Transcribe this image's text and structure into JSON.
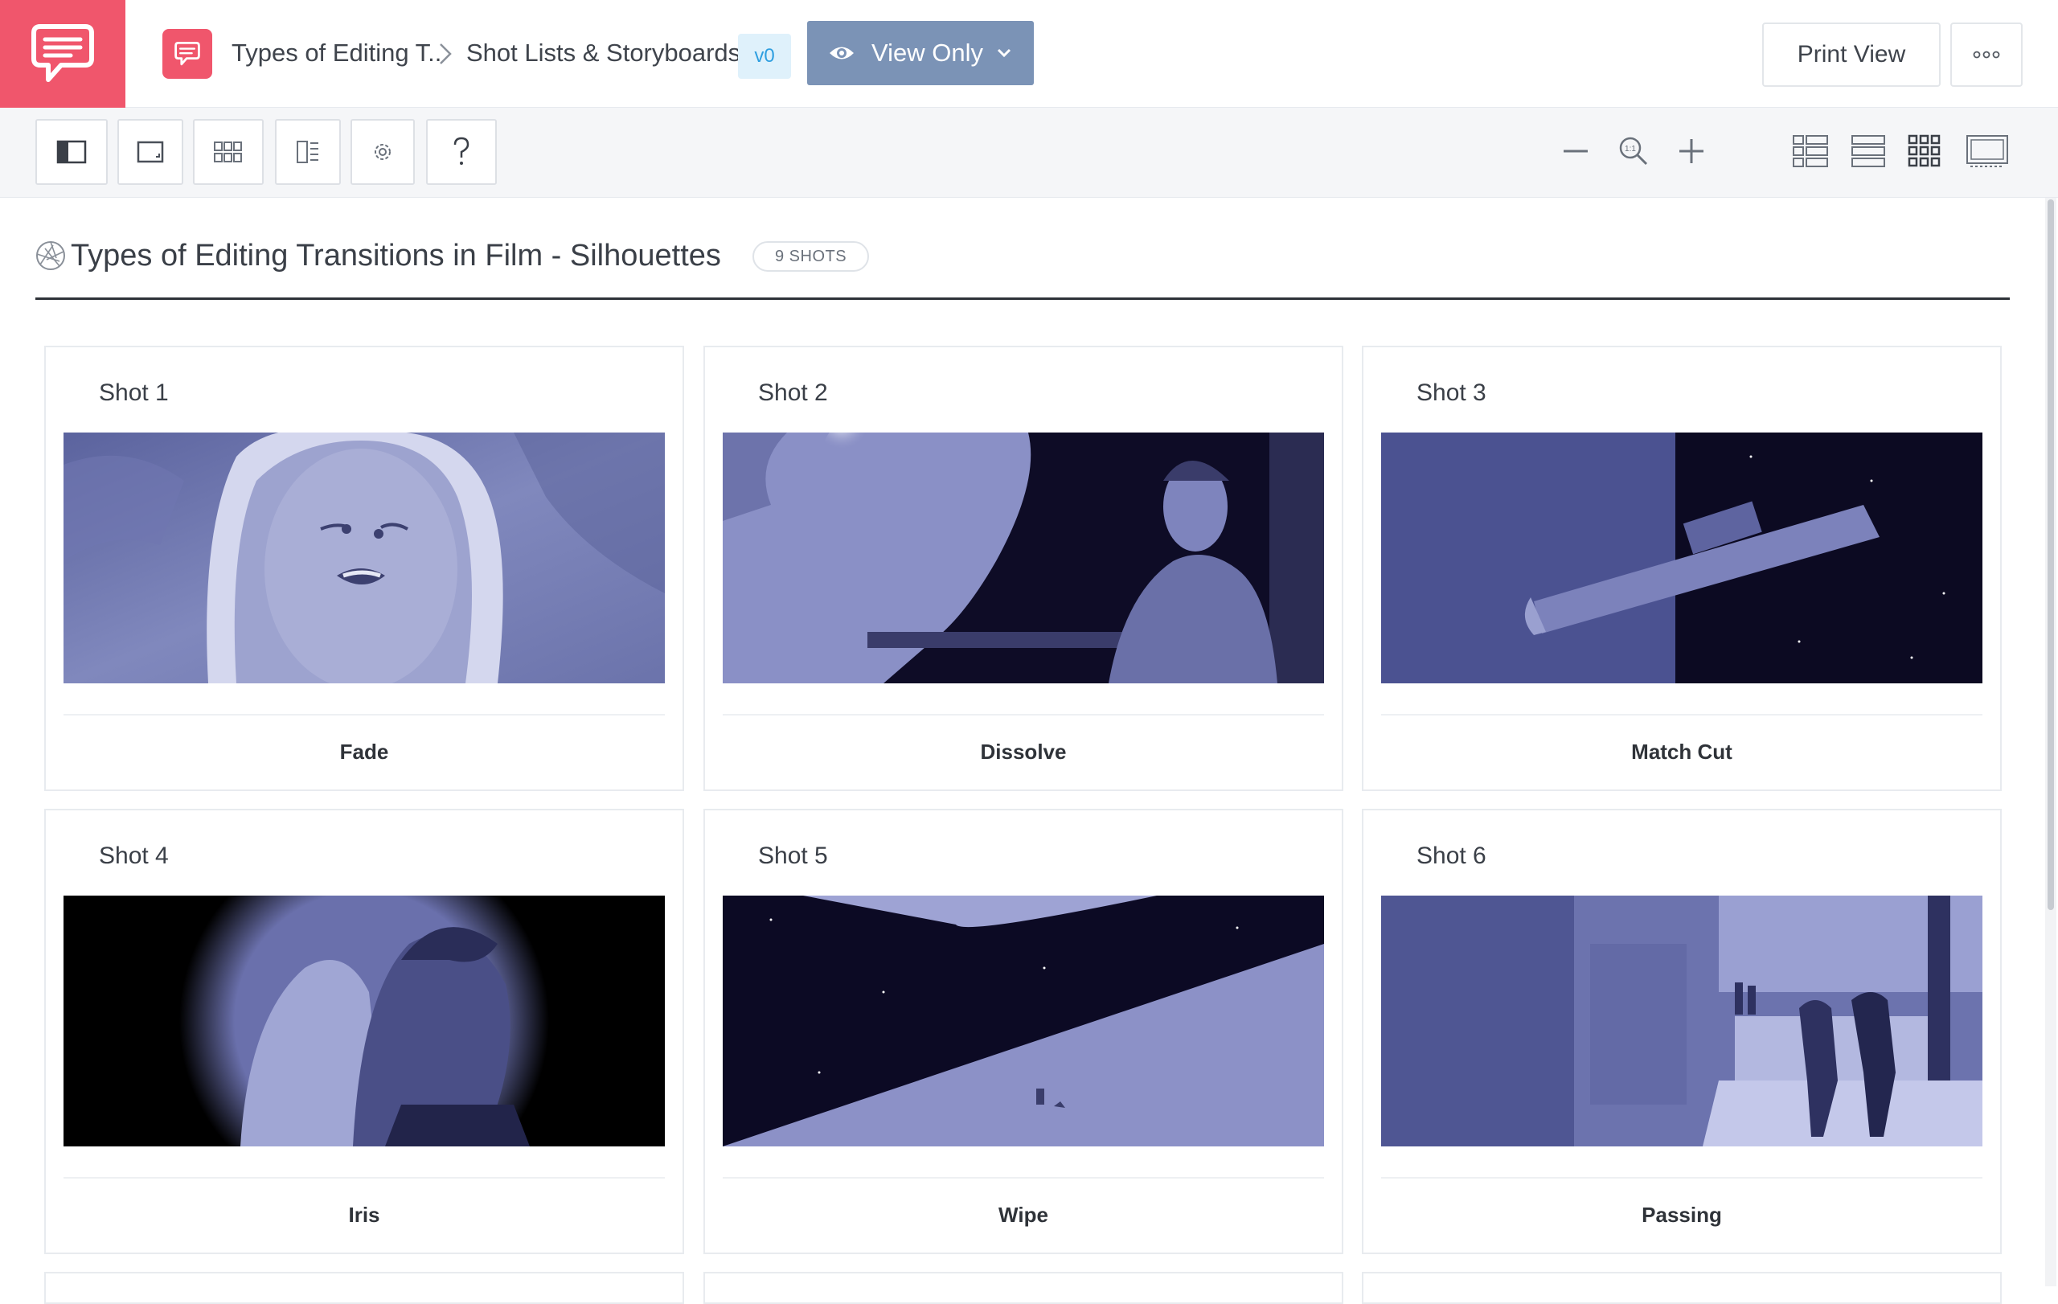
{
  "header": {
    "breadcrumb": [
      "Types of Editing T..",
      "Shot Lists & Storyboards"
    ],
    "version": "v0",
    "view_mode": "View Only",
    "print_label": "Print View",
    "colors": {
      "brand": "#f0566c",
      "view_mode_bg": "#7b93b6",
      "version_bg": "#dff1fb",
      "version_text": "#2f9fe0"
    }
  },
  "toolbar": {
    "left_buttons": [
      "sidebar-toggle-icon",
      "frame-icon",
      "grid-icon",
      "columns-icon",
      "gear-icon",
      "help-icon"
    ],
    "zoom_controls": [
      "minus-icon",
      "zoom-reset-icon",
      "plus-icon"
    ],
    "layout_views": [
      "list-detail-icon",
      "list-icon",
      "grid-view-icon",
      "presentation-icon"
    ]
  },
  "page": {
    "title": "Types of Editing Transitions in Film - Silhouettes",
    "shot_count": "9 SHOTS"
  },
  "shots": [
    {
      "title": "Shot 1",
      "label": "Fade"
    },
    {
      "title": "Shot 2",
      "label": "Dissolve"
    },
    {
      "title": "Shot 3",
      "label": "Match Cut"
    },
    {
      "title": "Shot 4",
      "label": "Iris"
    },
    {
      "title": "Shot 5",
      "label": "Wipe"
    },
    {
      "title": "Shot 6",
      "label": "Passing"
    }
  ]
}
